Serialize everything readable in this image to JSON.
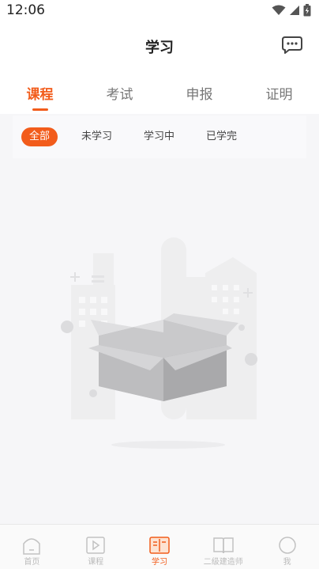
{
  "status_bar": {
    "time": "12:06"
  },
  "header": {
    "title": "学习"
  },
  "tabs": [
    {
      "label": "课程",
      "active": true
    },
    {
      "label": "考试",
      "active": false
    },
    {
      "label": "申报",
      "active": false
    },
    {
      "label": "证明",
      "active": false
    }
  ],
  "filters": [
    {
      "label": "全部",
      "active": true
    },
    {
      "label": "未学习",
      "active": false
    },
    {
      "label": "学习中",
      "active": false
    },
    {
      "label": "已学完",
      "active": false
    }
  ],
  "bottom_nav": [
    {
      "label": "首页",
      "icon": "home-icon",
      "active": false
    },
    {
      "label": "课程",
      "icon": "play-icon",
      "active": false
    },
    {
      "label": "学习",
      "icon": "book-icon",
      "active": true
    },
    {
      "label": "二级建造师",
      "icon": "open-book-icon",
      "active": false
    },
    {
      "label": "我",
      "icon": "profile-icon",
      "active": false
    }
  ],
  "colors": {
    "accent": "#f25c1b",
    "background": "#f6f6f8"
  }
}
